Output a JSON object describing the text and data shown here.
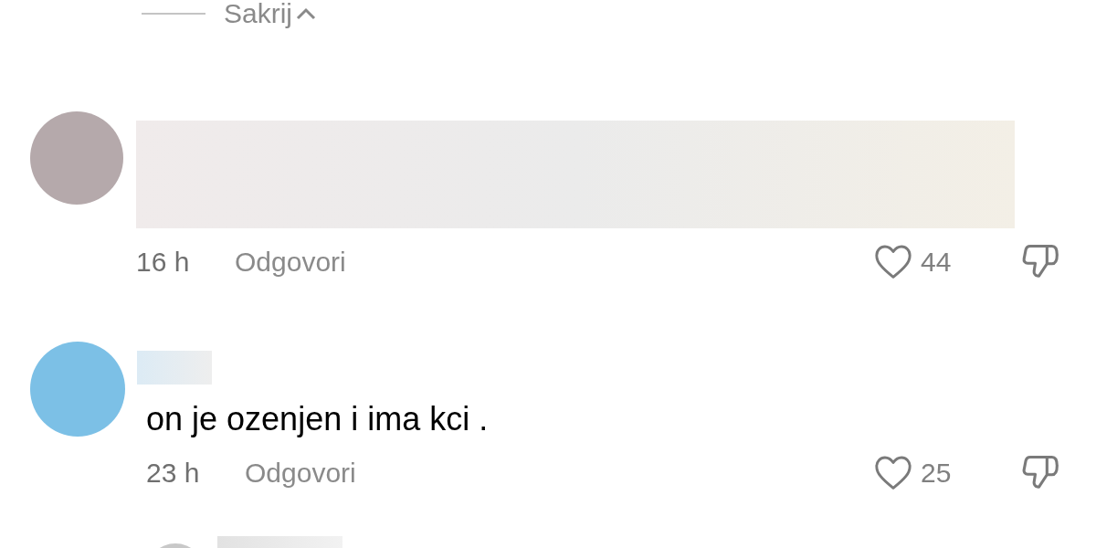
{
  "hide_replies": {
    "label": "Sakrij"
  },
  "comments": [
    {
      "kind": "redacted",
      "color": "#b5a9ab",
      "time": "16 h",
      "reply": "Odgovori",
      "likes": "44"
    },
    {
      "kind": "text",
      "color": "#7cc0e6",
      "text": "on je ozenjen i ima kci .",
      "time": "23 h",
      "reply": "Odgovori",
      "likes": "25"
    },
    {
      "kind": "partial",
      "color": "#c8c8c8"
    }
  ]
}
